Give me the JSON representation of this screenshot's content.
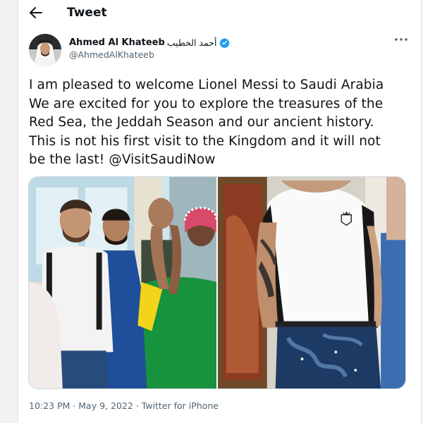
{
  "header": {
    "title": "Tweet",
    "back_icon": "arrow-left-icon"
  },
  "author": {
    "display_name": "Ahmed Al Khateeb",
    "arabic_name": "أحمد الخطيب",
    "handle": "@AhmedAlKhateeb",
    "verified_icon": "verified-badge-icon",
    "verified_color": "#1d9bf0"
  },
  "more_icon": "more-horizontal-icon",
  "tweet": {
    "lines": [
      "I am pleased to welcome Lionel Messi to Saudi Arabia",
      "We are excited for you to explore the treasures of the",
      "Red Sea, the Jeddah Season and our ancient history.",
      "This is not his first visit to the Kingdom and it will not",
      "be the last! "
    ],
    "mention": "@VisitSaudiNow"
  },
  "media": {
    "photo_count": 2
  },
  "meta": {
    "time": "10:23 PM",
    "separator": " · ",
    "date": "May 9, 2022",
    "source": "Twitter for iPhone"
  },
  "colors": {
    "text": "#0f1419",
    "secondary": "#536471",
    "border": "#cfd9de"
  }
}
